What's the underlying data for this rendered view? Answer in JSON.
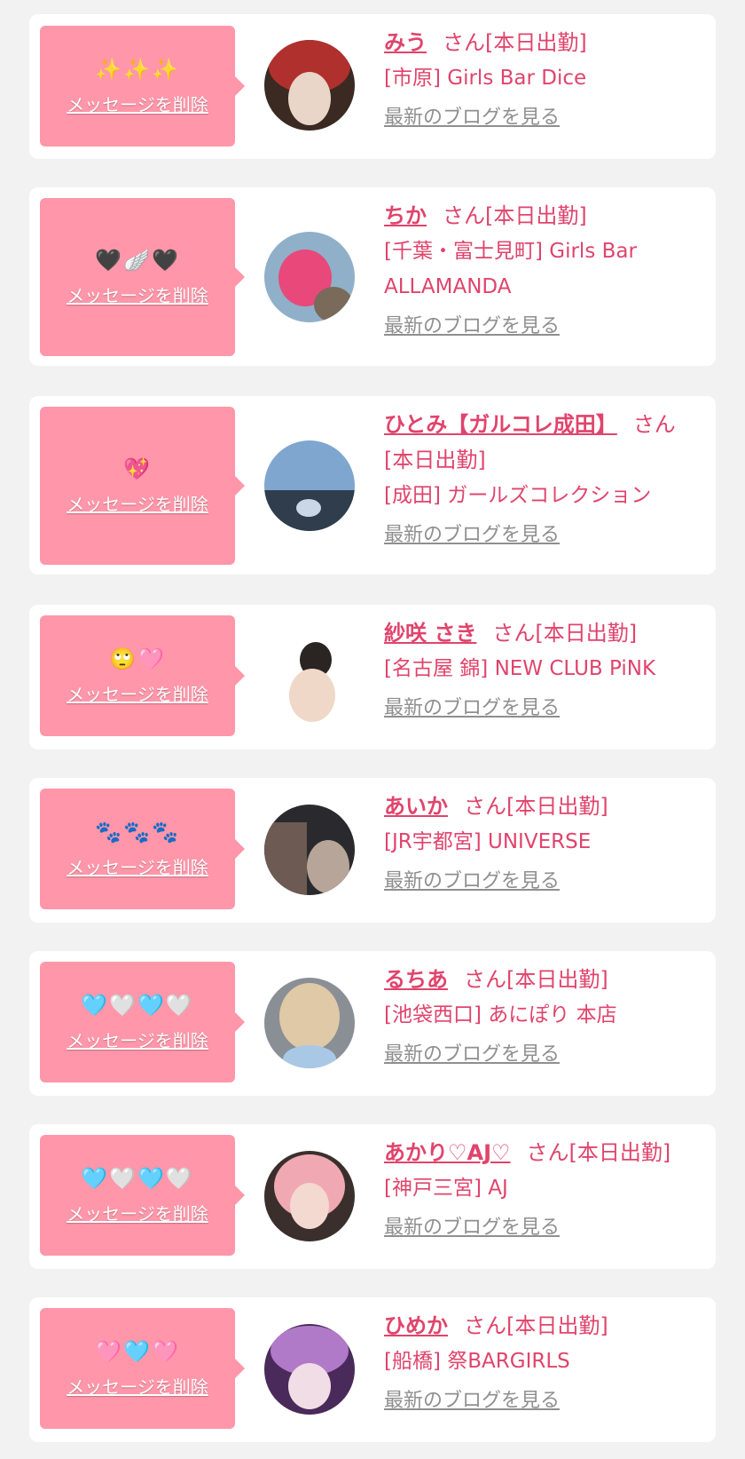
{
  "cards": [
    {
      "emoji": "✨✨✨",
      "delete_label": "メッセージを削除",
      "name": "みう",
      "suffix": "さん[本日出勤]",
      "shop": "[市原] Girls Bar Dice",
      "blog_label": "最新のブログを見る",
      "avatar_colors": [
        "#3a2a22",
        "#b0302e",
        "#e9d6c9"
      ]
    },
    {
      "emoji": "🖤🪽🖤",
      "delete_label": "メッセージを削除",
      "name": "ちか",
      "suffix": "さん[本日出勤]",
      "shop": "[千葉・富士見町] Girls Bar ALLAMANDA",
      "blog_label": "最新のブログを見る",
      "avatar_colors": [
        "#8fb0c8",
        "#e8487a",
        "#7a6a5a"
      ]
    },
    {
      "emoji": "💖",
      "delete_label": "メッセージを削除",
      "name": "ひとみ【ガルコレ成田】",
      "suffix": "さん[本日出勤]",
      "shop": "[成田] ガールズコレクション",
      "blog_label": "最新のブログを見る",
      "avatar_colors": [
        "#7fa6cf",
        "#2f3d4d",
        "#c9d7e6"
      ]
    },
    {
      "emoji": "🙄🩷",
      "delete_label": "メッセージを削除",
      "name": "紗咲 さき",
      "suffix": "さん[本日出勤]",
      "shop": "[名古屋 錦] NEW CLUB PiNK",
      "blog_label": "最新のブログを見る",
      "avatar_colors": [
        "#ffffff",
        "#2a2522",
        "#f0d8c8"
      ]
    },
    {
      "emoji": "🐾🐾🐾",
      "delete_label": "メッセージを削除",
      "name": "あいか",
      "suffix": "さん[本日出勤]",
      "shop": "[JR宇都宮] UNIVERSE",
      "blog_label": "最新のブログを見る",
      "avatar_colors": [
        "#2a2a2e",
        "#6d5a52",
        "#b7a59a"
      ]
    },
    {
      "emoji": "🩵🤍🩵🤍",
      "delete_label": "メッセージを削除",
      "name": "るちあ",
      "suffix": "さん[本日出勤]",
      "shop": "[池袋西口] あにぽり 本店",
      "blog_label": "最新のブログを見る",
      "avatar_colors": [
        "#8a8f95",
        "#e0c9a6",
        "#a9c8e6"
      ]
    },
    {
      "emoji": "🩵🤍🩵🤍",
      "delete_label": "メッセージを削除",
      "name": "あかり♡AJ♡",
      "suffix": "さん[本日出勤]",
      "shop": "[神戸三宮] AJ",
      "blog_label": "最新のブログを見る",
      "avatar_colors": [
        "#3a2f2c",
        "#f0a9b2",
        "#f3d9cf"
      ]
    },
    {
      "emoji": "🩷🩵🩷",
      "delete_label": "メッセージを削除",
      "name": "ひめか",
      "suffix": "さん[本日出勤]",
      "shop": "[船橋] 祭BARGIRLS",
      "blog_label": "最新のブログを見る",
      "avatar_colors": [
        "#4a2a5a",
        "#b07ac8",
        "#f1dde6"
      ]
    }
  ]
}
